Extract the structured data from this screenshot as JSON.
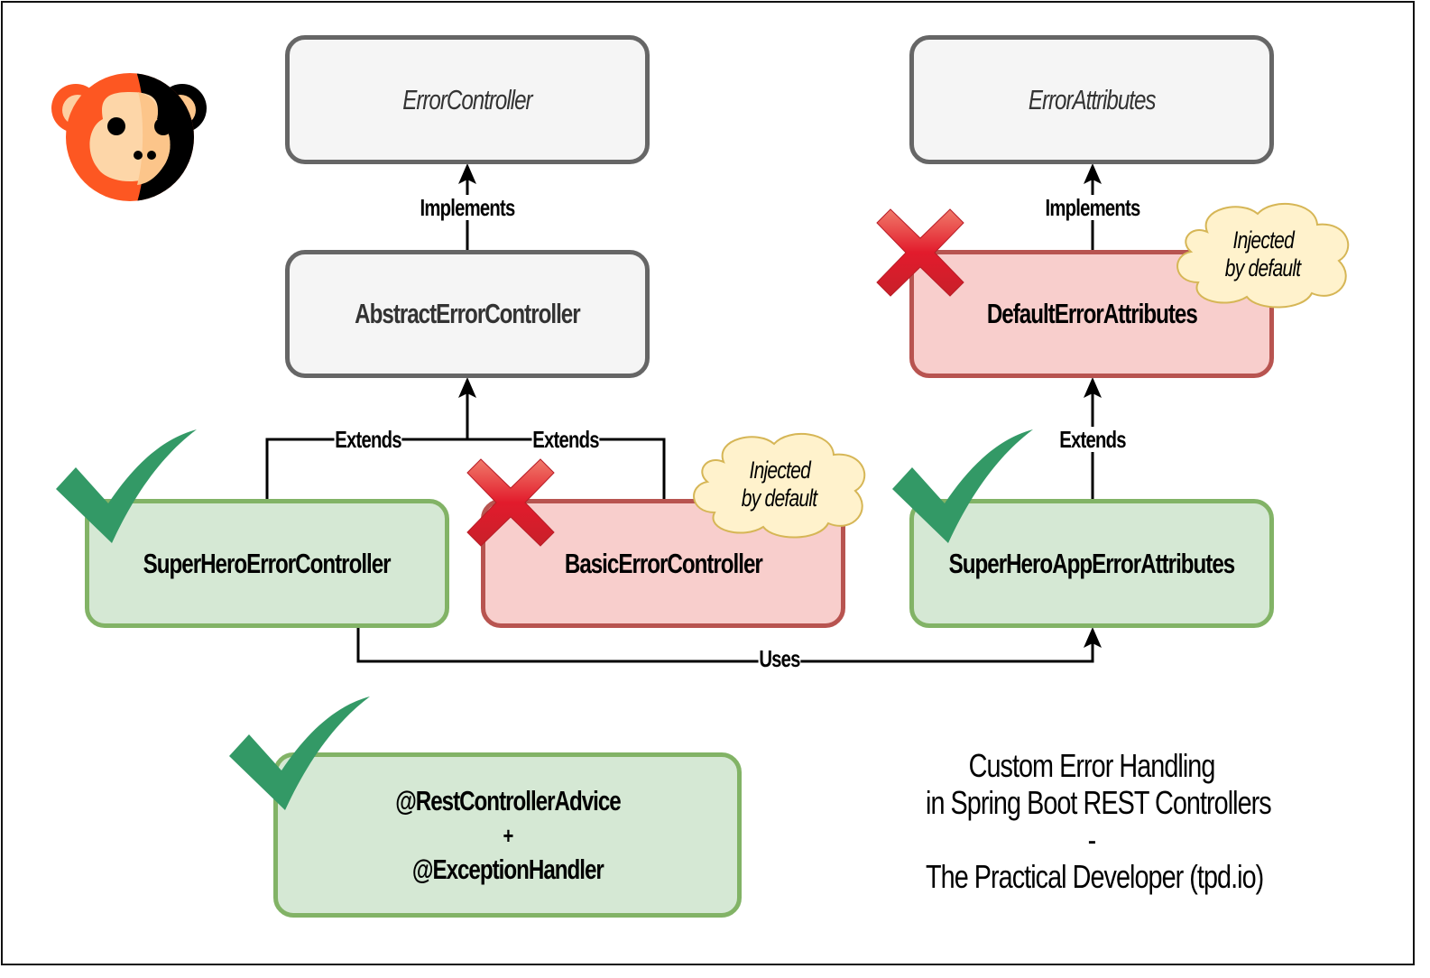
{
  "diagram": {
    "title_lines": [
      "Custom Error Handling",
      "in Spring Boot REST Controllers",
      "-",
      "The Practical Developer (tpd.io)"
    ],
    "logo": "monkey-logo-icon",
    "nodes": {
      "error_controller": {
        "label": "ErrorController",
        "kind": "interface",
        "status": "neutral"
      },
      "abstract_error_controller": {
        "label": "AbstractErrorController",
        "kind": "class",
        "status": "neutral"
      },
      "error_attributes": {
        "label": "ErrorAttributes",
        "kind": "interface",
        "status": "neutral"
      },
      "default_error_attributes": {
        "label": "DefaultErrorAttributes",
        "kind": "class",
        "status": "rejected"
      },
      "basic_error_controller": {
        "label": "BasicErrorController",
        "kind": "class",
        "status": "rejected"
      },
      "super_hero_error_controller": {
        "label": "SuperHeroErrorController",
        "kind": "class",
        "status": "approved"
      },
      "super_hero_app_error_attributes": {
        "label": "SuperHeroAppErrorAttributes",
        "kind": "class",
        "status": "approved"
      },
      "rest_controller_advice": {
        "lines": [
          "@RestControllerAdvice",
          "+",
          "@ExceptionHandler"
        ],
        "status": "approved"
      }
    },
    "edges": {
      "abstract_implements": {
        "label": "Implements",
        "from": "AbstractErrorController",
        "to": "ErrorController"
      },
      "default_implements": {
        "label": "Implements",
        "from": "DefaultErrorAttributes",
        "to": "ErrorAttributes"
      },
      "superhero_extends": {
        "label": "Extends",
        "from": "SuperHeroErrorController",
        "to": "AbstractErrorController"
      },
      "basic_extends": {
        "label": "Extends",
        "from": "BasicErrorController",
        "to": "AbstractErrorController"
      },
      "app_attrs_extends": {
        "label": "Extends",
        "from": "SuperHeroAppErrorAttributes",
        "to": "DefaultErrorAttributes"
      },
      "uses": {
        "label": "Uses",
        "from": "SuperHeroErrorController",
        "to": "SuperHeroAppErrorAttributes"
      }
    },
    "notes": {
      "basic_injected": {
        "lines": [
          "Injected",
          "by default"
        ]
      },
      "default_injected": {
        "lines": [
          "Injected",
          "by default"
        ]
      }
    },
    "colors": {
      "neutral_fill": "#f5f5f5",
      "neutral_stroke": "#666666",
      "rejected_fill": "#f8cecc",
      "rejected_stroke": "#b85450",
      "approved_fill": "#d5e8d4",
      "approved_stroke": "#82b366",
      "note_fill": "#fff2cc",
      "note_stroke": "#d6b656",
      "check": "#339966",
      "cross": "#e02030"
    }
  }
}
